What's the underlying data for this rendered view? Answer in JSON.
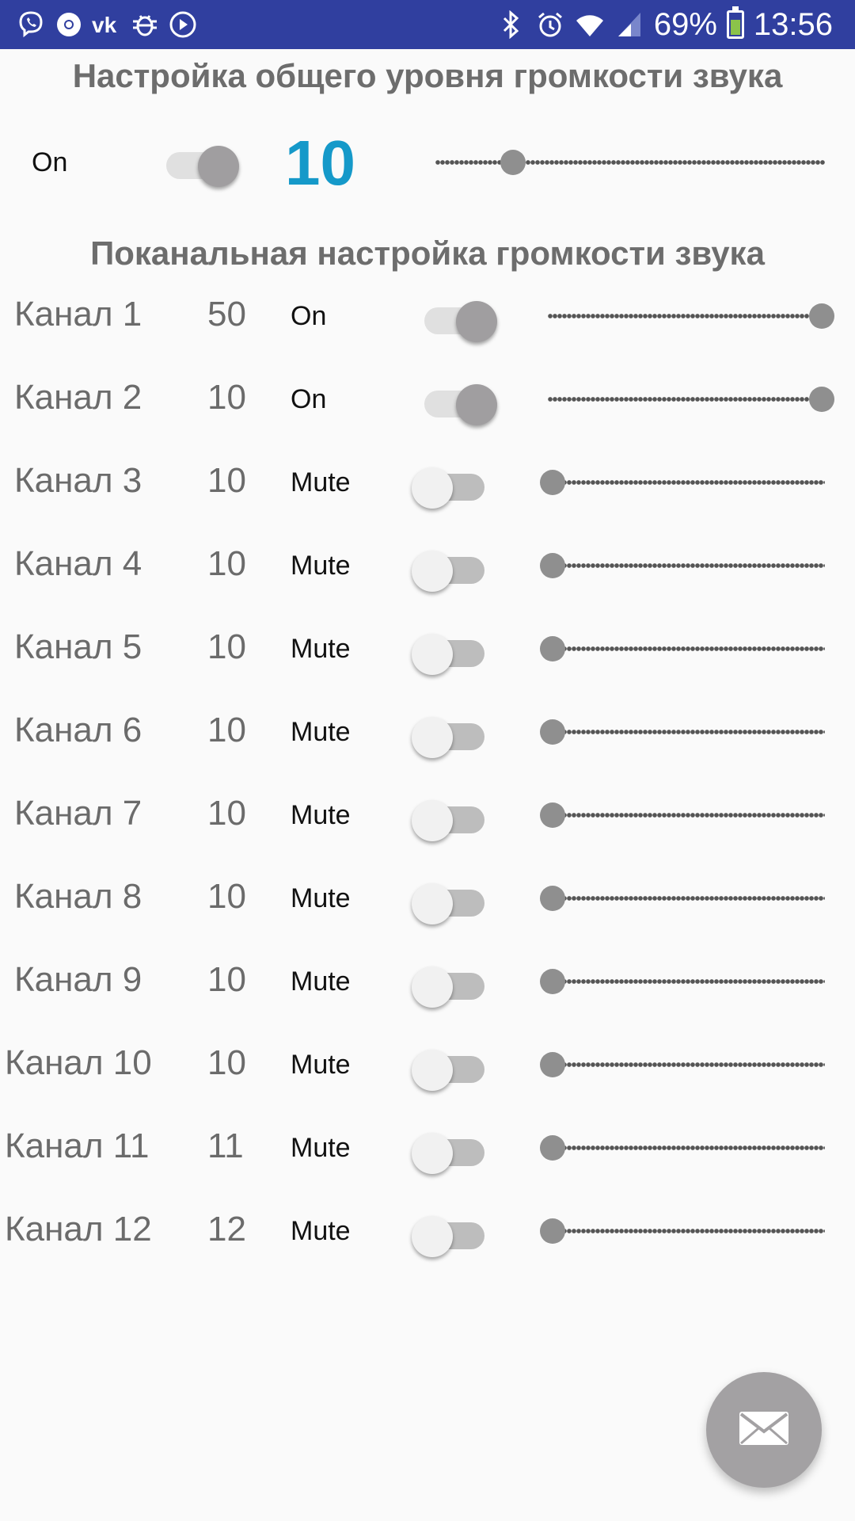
{
  "status_bar": {
    "battery": "69%",
    "time": "13:56",
    "left_icons": [
      "viber-icon",
      "chrome-icon",
      "vk-icon",
      "bug-icon",
      "play-icon"
    ],
    "right_icons": [
      "bluetooth-icon",
      "alarm-icon",
      "wifi-icon",
      "signal-icon",
      "battery-icon"
    ],
    "color": "#303f9f"
  },
  "master": {
    "title": "Настройка общего уровня громкости звука",
    "state_label": "On",
    "switch_on": true,
    "value": "10",
    "level": 0.2,
    "value_color": "#1599c9"
  },
  "channels_title": "Поканальная настройка громкости звука",
  "channels": [
    {
      "name": "Канал 1",
      "value": "50",
      "state": "On",
      "on": true,
      "level": 1.0
    },
    {
      "name": "Канал 2",
      "value": "10",
      "state": "On",
      "on": true,
      "level": 1.0
    },
    {
      "name": "Канал 3",
      "value": "10",
      "state": "Mute",
      "on": false,
      "level": 0.0
    },
    {
      "name": "Канал 4",
      "value": "10",
      "state": "Mute",
      "on": false,
      "level": 0.0
    },
    {
      "name": "Канал 5",
      "value": "10",
      "state": "Mute",
      "on": false,
      "level": 0.0
    },
    {
      "name": "Канал 6",
      "value": "10",
      "state": "Mute",
      "on": false,
      "level": 0.0
    },
    {
      "name": "Канал 7",
      "value": "10",
      "state": "Mute",
      "on": false,
      "level": 0.0
    },
    {
      "name": "Канал 8",
      "value": "10",
      "state": "Mute",
      "on": false,
      "level": 0.0
    },
    {
      "name": "Канал 9",
      "value": "10",
      "state": "Mute",
      "on": false,
      "level": 0.0
    },
    {
      "name": "Канал 10",
      "value": "10",
      "state": "Mute",
      "on": false,
      "level": 0.0
    },
    {
      "name": "Канал 11",
      "value": "11",
      "state": "Mute",
      "on": false,
      "level": 0.0
    },
    {
      "name": "Канал 12",
      "value": "12",
      "state": "Mute",
      "on": false,
      "level": 0.0
    }
  ],
  "fab": {
    "icon": "mail-icon"
  }
}
